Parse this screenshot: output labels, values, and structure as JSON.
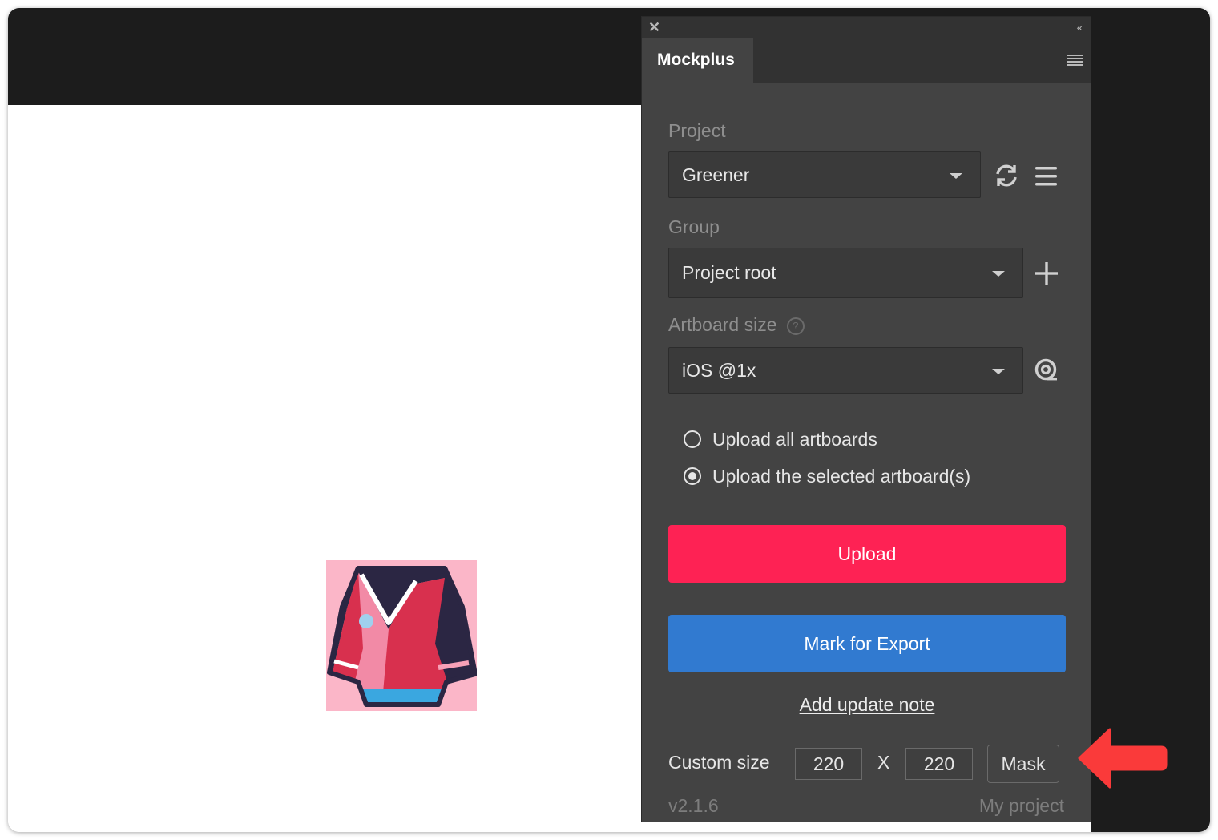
{
  "panel": {
    "tab_title": "Mockplus",
    "close_icon": "close-icon",
    "collapse_icon": "double-chevron-left-icon",
    "menu_icon": "panel-menu-icon"
  },
  "project": {
    "label": "Project",
    "selected": "Greener",
    "refresh_icon": "refresh-icon",
    "list_icon": "list-icon"
  },
  "group": {
    "label": "Group",
    "selected": "Project root",
    "add_icon": "plus-icon"
  },
  "artboard_size": {
    "label": "Artboard size",
    "help_icon": "help-circle-icon",
    "selected": "iOS @1x",
    "locate_icon": "target-icon"
  },
  "upload_options": [
    {
      "label": "Upload all artboards",
      "checked": false
    },
    {
      "label": "Upload the selected artboard(s)",
      "checked": true
    }
  ],
  "buttons": {
    "upload": "Upload",
    "mark_for_export": "Mark for Export",
    "add_update_note": "Add update note"
  },
  "custom_size": {
    "label": "Custom size",
    "width": "220",
    "separator": "X",
    "height": "220",
    "mask": "Mask"
  },
  "footer": {
    "version": "v2.1.6",
    "my_project": "My project"
  },
  "colors": {
    "upload": "#fe2254",
    "export": "#317ad0",
    "panel_bg": "#434343",
    "annotation_arrow": "#fa3a3a"
  }
}
